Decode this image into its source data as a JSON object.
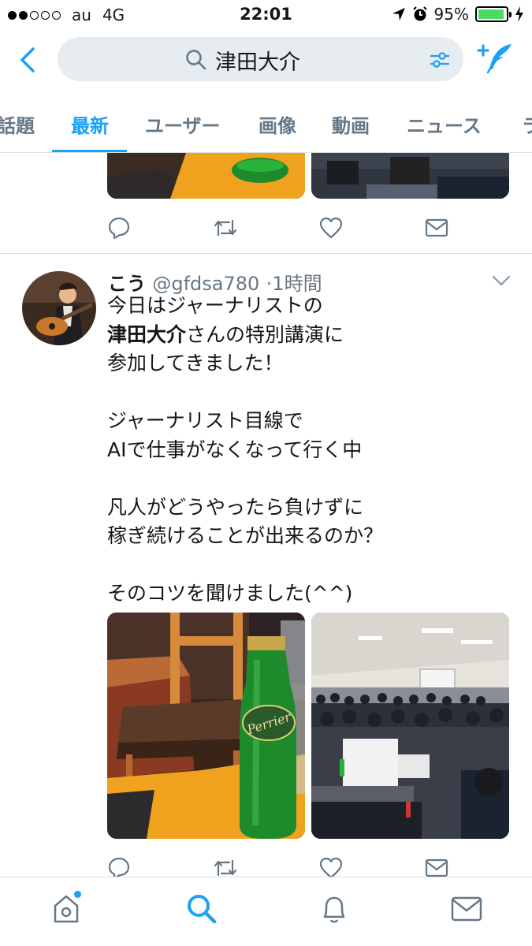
{
  "status_bar": {
    "carrier": "au",
    "network": "4G",
    "time": "22:01",
    "battery": "95%",
    "battery_fraction": 0.95,
    "signal_bars": 2
  },
  "search": {
    "query": "津田大介"
  },
  "tabs": [
    {
      "label": "話題"
    },
    {
      "label": "最新",
      "active": true
    },
    {
      "label": "ユーザー"
    },
    {
      "label": "画像"
    },
    {
      "label": "動画"
    },
    {
      "label": "ニュース"
    },
    {
      "label": "ラ"
    }
  ],
  "tweet": {
    "name": "こう",
    "handle": "@gfdsa780",
    "time": "1時間",
    "lines": [
      "今日はジャーナリストの",
      "津田大介さんの特別講演に",
      "参加してきました！",
      "",
      "ジャーナリスト目線で",
      "AIで仕事がなくなって行く中",
      "",
      "凡人がどうやったら負けずに",
      "稼ぎ続けることが出来るのか？",
      "",
      "そのコツを聞けました(^^)"
    ],
    "highlight": "津田大介"
  },
  "icons": {
    "back": "chevron-left-icon",
    "search": "search-icon",
    "filter": "filter-icon",
    "compose": "compose-icon",
    "reply": "reply-icon",
    "retweet": "retweet-icon",
    "like": "heart-icon",
    "dm": "mail-icon",
    "home": "home-icon",
    "notifications": "bell-icon",
    "messages": "mail-icon"
  },
  "colors": {
    "accent": "#1da1f2",
    "muted": "#657786",
    "battery": "#4cd964"
  }
}
